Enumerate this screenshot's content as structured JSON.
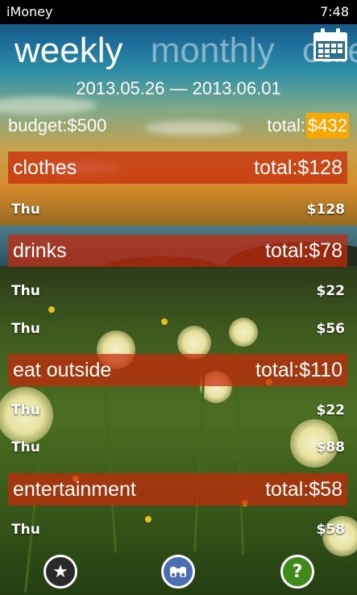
{
  "status": {
    "app_name": "iMoney",
    "time": "7:48"
  },
  "tabs": [
    {
      "label": "weekly",
      "active": true
    },
    {
      "label": "monthly",
      "active": false
    },
    {
      "label": "calendar",
      "active": false
    }
  ],
  "calendar_icon": "calendar-icon",
  "date_range": "2013.05.26 — 2013.06.01",
  "budget_label": "budget:$500",
  "total_label": "total:",
  "total_value": "$432",
  "categories": [
    {
      "name": "clothes",
      "total": "total:$128",
      "items": [
        {
          "day": "Thu",
          "amount": "$128"
        }
      ]
    },
    {
      "name": "drinks",
      "total": "total:$78",
      "items": [
        {
          "day": "Thu",
          "amount": "$22"
        },
        {
          "day": "Thu",
          "amount": "$56"
        }
      ]
    },
    {
      "name": "eat outside",
      "total": "total:$110",
      "items": [
        {
          "day": "Thu",
          "amount": "$22"
        },
        {
          "day": "Thu",
          "amount": "$88"
        }
      ]
    },
    {
      "name": "entertainment",
      "total": "total:$58",
      "items": [
        {
          "day": "Thu",
          "amount": "$58"
        }
      ]
    }
  ],
  "appbar": [
    {
      "icon": "star-icon",
      "glyph": "★",
      "color": "#2a2a2a"
    },
    {
      "icon": "binoculars-icon",
      "glyph": "",
      "color": "#4a6fb0"
    },
    {
      "icon": "help-icon",
      "glyph": "?",
      "color": "#3f8a1a"
    }
  ],
  "colors": {
    "accent": "#f5a800",
    "category_bar": "#c8280a"
  }
}
